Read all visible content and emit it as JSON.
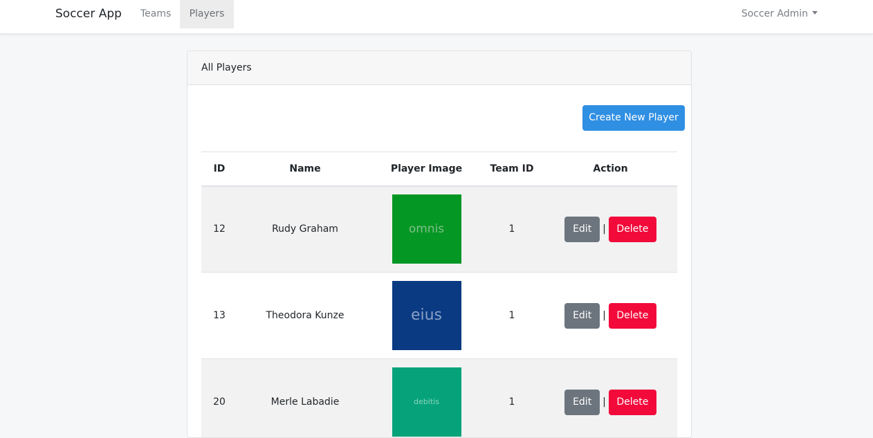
{
  "navbar": {
    "brand": "Soccer App",
    "links": [
      {
        "label": "Teams"
      },
      {
        "label": "Players"
      }
    ],
    "user_menu": "Soccer Admin"
  },
  "card": {
    "title": "All Players",
    "create_button": "Create New Player"
  },
  "table": {
    "headers": {
      "id": "ID",
      "name": "Name",
      "image": "Player Image",
      "team_id": "Team ID",
      "action": "Action"
    },
    "rows": [
      {
        "id": "12",
        "name": "Rudy Graham",
        "image_text": "omnis",
        "image_bg": "#059724",
        "image_fg": "#7fbf8a",
        "team_id": "1",
        "edit": "Edit",
        "separator": "|",
        "delete": "Delete"
      },
      {
        "id": "13",
        "name": "Theodora Kunze",
        "image_text": "eius",
        "image_bg": "#0a3a82",
        "image_fg": "#8aa0c6",
        "team_id": "1",
        "edit": "Edit",
        "separator": "|",
        "delete": "Delete"
      },
      {
        "id": "20",
        "name": "Merle Labadie",
        "image_text": "debitis",
        "image_bg": "#06a37a",
        "image_fg": "#8fd4c0",
        "team_id": "1",
        "edit": "Edit",
        "separator": "|",
        "delete": "Delete"
      }
    ]
  },
  "colors": {
    "primary": "#2f8fe3",
    "secondary": "#6c757d",
    "danger": "#f20a3b"
  }
}
